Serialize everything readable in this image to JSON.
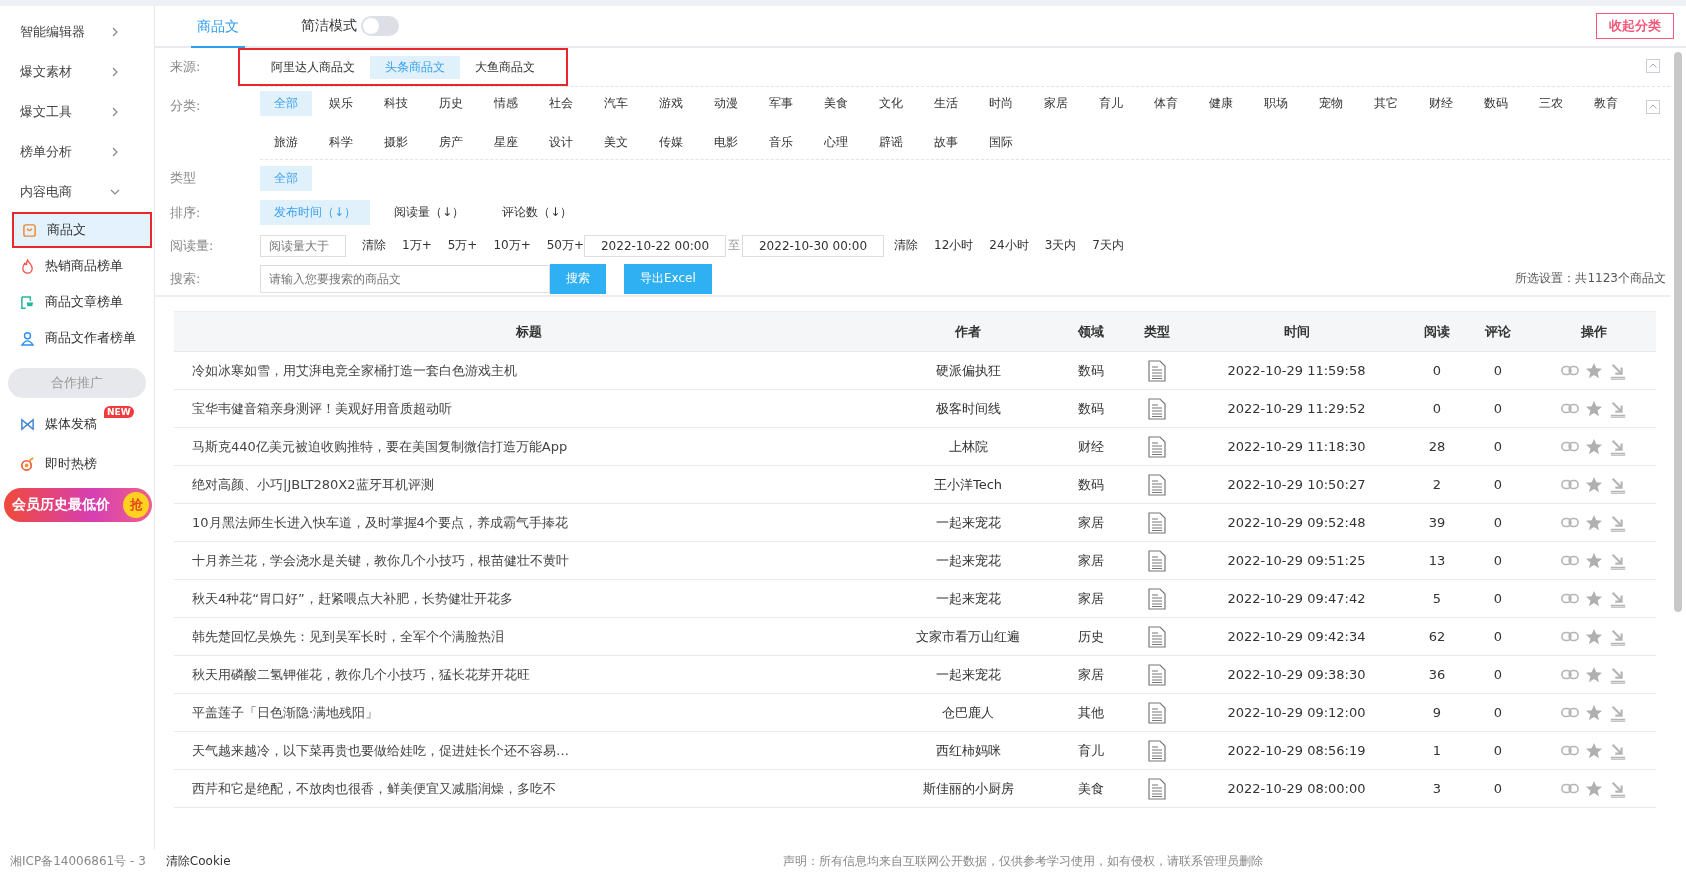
{
  "sidebar": {
    "menus": [
      {
        "label": "智能编辑器",
        "expanded": false
      },
      {
        "label": "爆文素材",
        "expanded": false
      },
      {
        "label": "爆文工具",
        "expanded": false
      },
      {
        "label": "榜单分析",
        "expanded": false
      },
      {
        "label": "内容电商",
        "expanded": true,
        "children": [
          {
            "label": "商品文",
            "selected": true,
            "outlined": true
          },
          {
            "label": "热销商品榜单",
            "selected": false,
            "outlined": false
          },
          {
            "label": "商品文章榜单",
            "selected": false,
            "outlined": false
          },
          {
            "label": "商品文作者榜单",
            "selected": false,
            "outlined": false
          }
        ]
      }
    ],
    "promo_button": "合作推广",
    "links": [
      {
        "label": "媒体发稿",
        "badge": "NEW"
      },
      {
        "label": "即时热榜"
      }
    ],
    "banner": {
      "text": "会员历史最低价",
      "badge": "抢"
    }
  },
  "tabs": [
    {
      "label": "商品文",
      "selected": true
    }
  ],
  "mode_toggle": {
    "label": "简洁模式",
    "on": false
  },
  "collapse_button": "收起分类",
  "filters": {
    "source": {
      "label": "来源:",
      "outlined": true,
      "options": [
        {
          "label": "阿里达人商品文",
          "selected": false
        },
        {
          "label": "头条商品文",
          "selected": true
        },
        {
          "label": "大鱼商品文",
          "selected": false
        }
      ]
    },
    "category": {
      "label": "分类:",
      "options": [
        {
          "label": "全部",
          "selected": true
        },
        {
          "label": "娱乐",
          "selected": false
        },
        {
          "label": "科技",
          "selected": false
        },
        {
          "label": "历史",
          "selected": false
        },
        {
          "label": "情感",
          "selected": false
        },
        {
          "label": "社会",
          "selected": false
        },
        {
          "label": "汽车",
          "selected": false
        },
        {
          "label": "游戏",
          "selected": false
        },
        {
          "label": "动漫",
          "selected": false
        },
        {
          "label": "军事",
          "selected": false
        },
        {
          "label": "美食",
          "selected": false
        },
        {
          "label": "文化",
          "selected": false
        },
        {
          "label": "生活",
          "selected": false
        },
        {
          "label": "时尚",
          "selected": false
        },
        {
          "label": "家居",
          "selected": false
        },
        {
          "label": "育儿",
          "selected": false
        },
        {
          "label": "体育",
          "selected": false
        },
        {
          "label": "健康",
          "selected": false
        },
        {
          "label": "职场",
          "selected": false
        },
        {
          "label": "宠物",
          "selected": false
        },
        {
          "label": "其它",
          "selected": false
        },
        {
          "label": "财经",
          "selected": false
        },
        {
          "label": "数码",
          "selected": false
        },
        {
          "label": "三农",
          "selected": false
        },
        {
          "label": "教育",
          "selected": false
        },
        {
          "label": "旅游",
          "selected": false
        },
        {
          "label": "科学",
          "selected": false
        },
        {
          "label": "摄影",
          "selected": false
        },
        {
          "label": "房产",
          "selected": false
        },
        {
          "label": "星座",
          "selected": false
        },
        {
          "label": "设计",
          "selected": false
        },
        {
          "label": "美文",
          "selected": false
        },
        {
          "label": "传媒",
          "selected": false
        },
        {
          "label": "电影",
          "selected": false
        },
        {
          "label": "音乐",
          "selected": false
        },
        {
          "label": "心理",
          "selected": false
        },
        {
          "label": "辟谣",
          "selected": false
        },
        {
          "label": "故事",
          "selected": false
        },
        {
          "label": "国际",
          "selected": false
        }
      ]
    },
    "type": {
      "label": "类型",
      "options": [
        {
          "label": "全部",
          "selected": true
        }
      ]
    },
    "sort": {
      "label": "排序:",
      "options": [
        {
          "label": "发布时间（↓）",
          "selected": true
        },
        {
          "label": "阅读量（↓）",
          "selected": false
        },
        {
          "label": "评论数（↓）",
          "selected": false
        }
      ]
    },
    "reads": {
      "label": "阅读量:",
      "placeholder": "阅读量大于",
      "clear": "清除",
      "presets": [
        "1万+",
        "5万+",
        "10万+",
        "50万+"
      ],
      "date_from": "2022-10-22 00:00",
      "to": "至",
      "date_to": "2022-10-30 00:00",
      "clear_dates": "清除",
      "ranges": [
        "12小时",
        "24小时",
        "3天内",
        "7天内"
      ]
    },
    "search": {
      "label": "搜索:",
      "placeholder": "请输入您要搜索的商品文",
      "button": "搜索",
      "export": "导出Excel",
      "summary": "所选设置：共1123个商品文"
    }
  },
  "table": {
    "columns": [
      "标题",
      "作者",
      "领域",
      "类型",
      "时间",
      "阅读",
      "评论",
      "操作"
    ],
    "rows": [
      {
        "title": "冷如冰寒如雪，用艾湃电竞全家桶打造一套白色游戏主机",
        "author": "硬派偏执狂",
        "domain": "数码",
        "kind": "article",
        "time": "2022-10-29 11:59:58",
        "reads": "0",
        "comments": "0"
      },
      {
        "title": "宝华韦健音箱亲身测评！美观好用音质超动听",
        "author": "极客时间线",
        "domain": "数码",
        "kind": "article",
        "time": "2022-10-29 11:29:52",
        "reads": "0",
        "comments": "0"
      },
      {
        "title": "马斯克440亿美元被迫收购推特，要在美国复制微信打造万能App",
        "author": "上林院",
        "domain": "财经",
        "kind": "article",
        "time": "2022-10-29 11:18:30",
        "reads": "28",
        "comments": "0"
      },
      {
        "title": "绝对高颜、小巧|JBLT280X2蓝牙耳机评测",
        "author": "王小洋Tech",
        "domain": "数码",
        "kind": "article",
        "time": "2022-10-29 10:50:27",
        "reads": "2",
        "comments": "0"
      },
      {
        "title": "10月黑法师生长进入快车道，及时掌握4个要点，养成霸气手捧花",
        "author": "一起来宠花",
        "domain": "家居",
        "kind": "article",
        "time": "2022-10-29 09:52:48",
        "reads": "39",
        "comments": "0"
      },
      {
        "title": "十月养兰花，学会浇水是关键，教你几个小技巧，根苗健壮不黄叶",
        "author": "一起来宠花",
        "domain": "家居",
        "kind": "article",
        "time": "2022-10-29 09:51:25",
        "reads": "13",
        "comments": "0"
      },
      {
        "title": "秋天4种花“胃口好”，赶紧喂点大补肥，长势健壮开花多",
        "author": "一起来宠花",
        "domain": "家居",
        "kind": "article",
        "time": "2022-10-29 09:47:42",
        "reads": "5",
        "comments": "0"
      },
      {
        "title": "韩先楚回忆吴焕先：见到吴军长时，全军个个满脸热泪",
        "author": "文家市看万山红遍",
        "domain": "历史",
        "kind": "article",
        "time": "2022-10-29 09:42:34",
        "reads": "62",
        "comments": "0"
      },
      {
        "title": "秋天用磷酸二氢钾催花，教你几个小技巧，猛长花芽开花旺",
        "author": "一起来宠花",
        "domain": "家居",
        "kind": "article",
        "time": "2022-10-29 09:38:30",
        "reads": "36",
        "comments": "0"
      },
      {
        "title": "平盖莲子「日色渐隐·满地残阳」",
        "author": "仓巴鹿人",
        "domain": "其他",
        "kind": "article",
        "time": "2022-10-29 09:12:00",
        "reads": "9",
        "comments": "0"
      },
      {
        "title": "天气越来越冷，以下菜再贵也要做给娃吃，促进娃长个还不容易…",
        "author": "西红柿妈咪",
        "domain": "育儿",
        "kind": "article",
        "time": "2022-10-29 08:56:19",
        "reads": "1",
        "comments": "0"
      },
      {
        "title": "西芹和它是绝配，不放肉也很香，鲜美便宜又减脂润燥，多吃不",
        "author": "斯佳丽的小厨房",
        "domain": "美食",
        "kind": "article",
        "time": "2022-10-29 08:00:00",
        "reads": "3",
        "comments": "0"
      }
    ]
  },
  "footer": {
    "icp": "湘ICP备14006861号 - 3",
    "clear_cookie": "清除Cookie",
    "disclaimer": "声明：所有信息均来自互联网公开数据，仅供参考学习使用，如有侵权，请联系管理员删除"
  }
}
